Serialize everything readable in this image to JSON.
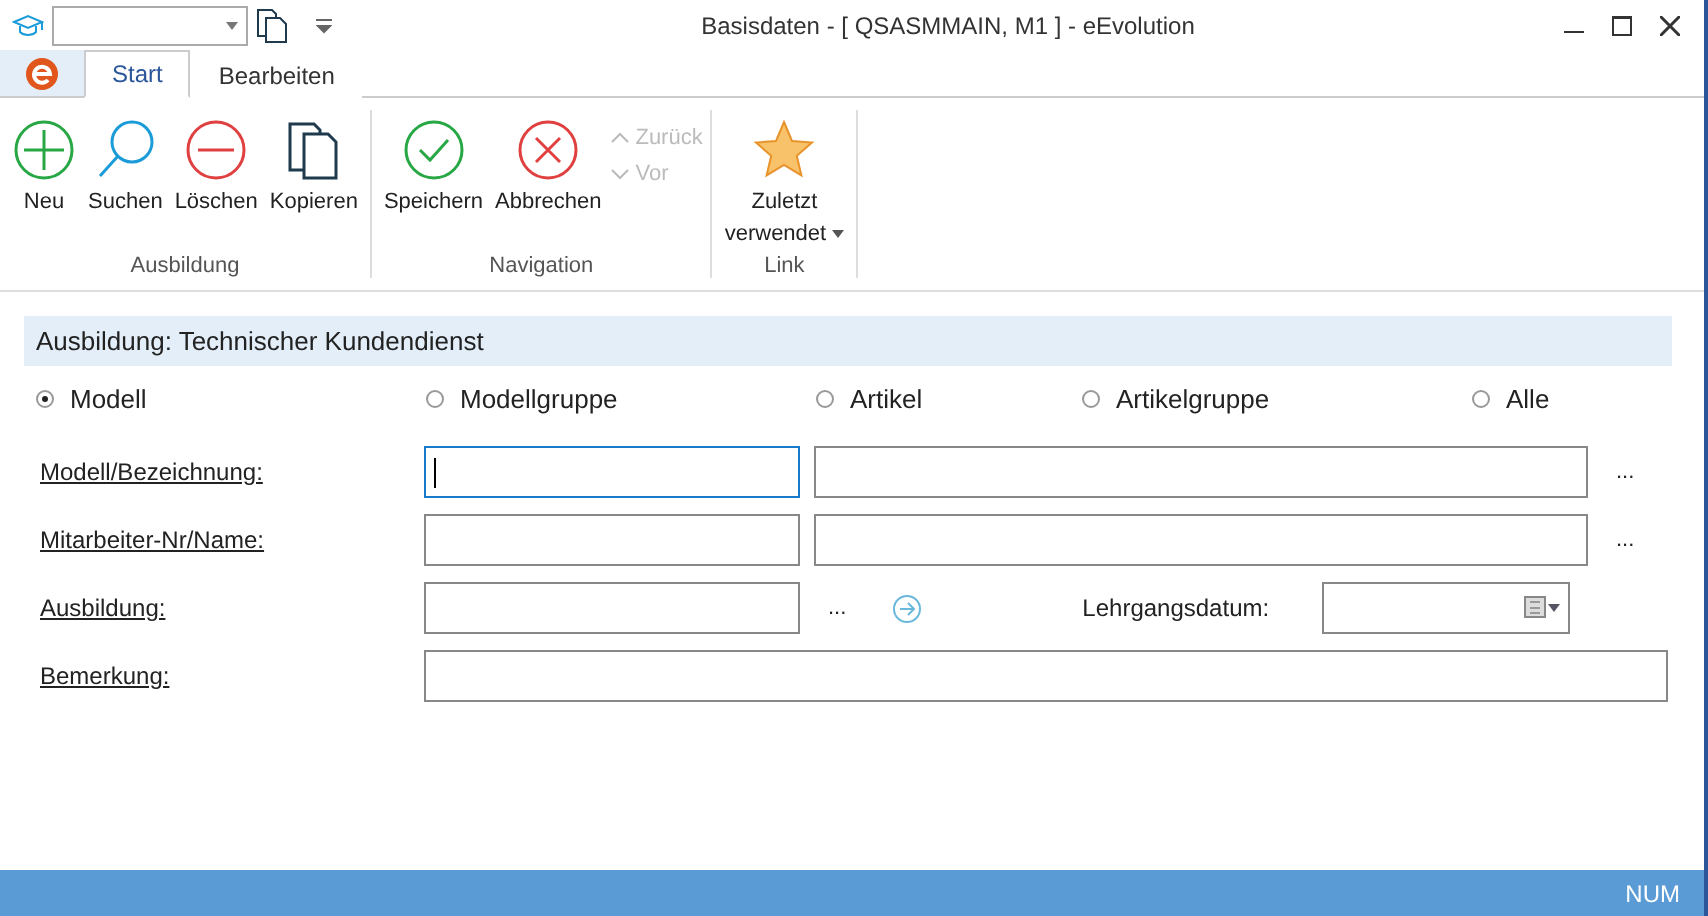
{
  "window": {
    "title": "Basisdaten - [ QSASMMAIN, M1 ]  -  eEvolution"
  },
  "tabs": [
    {
      "label": "Start",
      "selected": true
    },
    {
      "label": "Bearbeiten",
      "selected": false
    }
  ],
  "ribbon_groups": [
    {
      "label": "Ausbildung",
      "buttons": [
        {
          "kind": "add",
          "label": "Neu",
          "disabled": false
        },
        {
          "kind": "search",
          "label": "Suchen",
          "disabled": false
        },
        {
          "kind": "delete",
          "label": "Löschen",
          "disabled": false
        },
        {
          "kind": "copy",
          "label": "Kopieren",
          "disabled": false
        }
      ]
    },
    {
      "label": "Navigation",
      "buttons": [
        {
          "kind": "save",
          "label": "Speichern",
          "disabled": false
        },
        {
          "kind": "cancel",
          "label": "Abbrechen",
          "disabled": false
        },
        {
          "kind": "up",
          "label": "Zurück",
          "disabled": true
        },
        {
          "kind": "down",
          "label": "Vor",
          "disabled": true
        }
      ]
    },
    {
      "label": "Link",
      "buttons": [
        {
          "kind": "star",
          "label": "Zuletzt",
          "label_2": "verwendet",
          "disabled": false
        }
      ]
    }
  ],
  "panel": {
    "title": "Ausbildung: Technischer Kundendienst"
  },
  "radios": [
    {
      "label": "Modell",
      "selected": true
    },
    {
      "label": "Modellgruppe",
      "selected": false
    },
    {
      "label": "Artikel",
      "selected": false
    },
    {
      "label": "Artikelgruppe",
      "selected": false
    },
    {
      "label": "Alle",
      "selected": false
    }
  ],
  "rows": [
    {
      "kind": "double",
      "label": "Modell/Bezeichnung:",
      "focused": true,
      "dots": "..."
    },
    {
      "kind": "double",
      "label": "Mitarbeiter-Nr/Name:",
      "focused": false,
      "dots": "..."
    },
    {
      "kind": "course",
      "label": "Ausbildung:",
      "dots": "...",
      "date_label": "Lehrgangsdatum:"
    },
    {
      "kind": "wide",
      "label": "Bemerkung:"
    }
  ],
  "status_bar": {
    "text": "NUM"
  }
}
